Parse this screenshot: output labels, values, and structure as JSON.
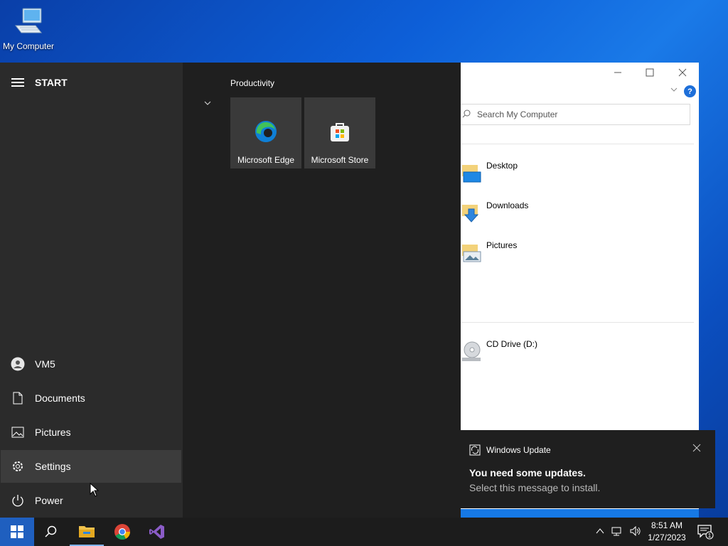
{
  "desktop": {
    "icon_label": "My Computer"
  },
  "explorer": {
    "search_placeholder": "Search My Computer",
    "help_label": "?",
    "folders": [
      "Desktop",
      "Downloads",
      "Pictures"
    ],
    "drive": "CD Drive (D:)"
  },
  "start": {
    "title": "START",
    "user": "VM5",
    "items": [
      "Documents",
      "Pictures",
      "Settings",
      "Power"
    ],
    "group": "Productivity",
    "tiles": [
      "Microsoft Edge",
      "Microsoft Store"
    ]
  },
  "toast": {
    "app": "Windows Update",
    "title": "You need some updates.",
    "message": "Select this message to install."
  },
  "tray": {
    "time": "8:51 AM",
    "date": "1/27/2023",
    "notification_count": "1"
  },
  "colors": {
    "accent": "#1f5fbf",
    "menu_left": "#2b2b2b",
    "menu_right": "#1f1f1f"
  }
}
